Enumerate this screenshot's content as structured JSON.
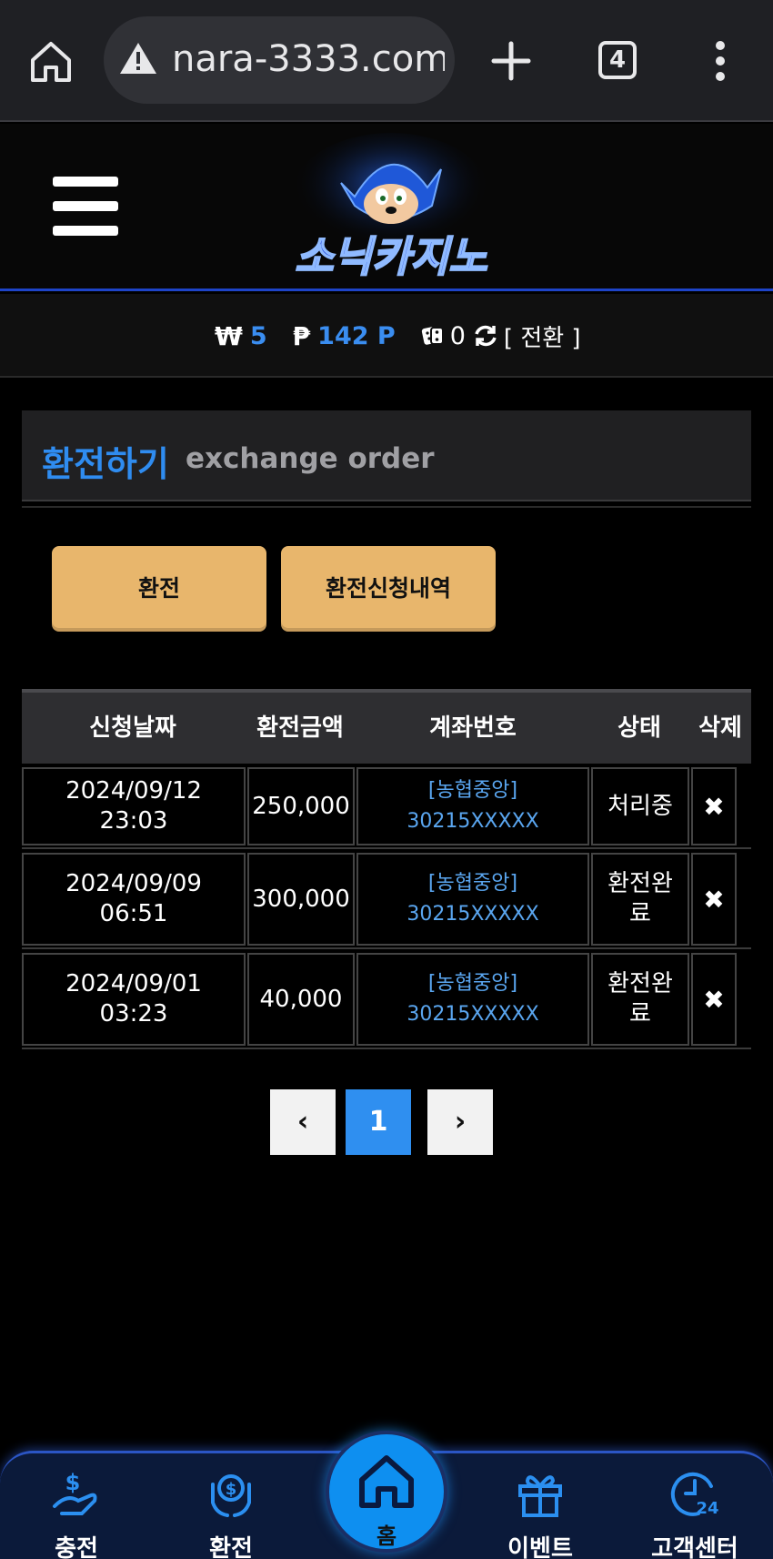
{
  "browser": {
    "url": "nara-3333.com",
    "tab_count": "4"
  },
  "header": {
    "logo_text": "소닉카지노"
  },
  "balance": {
    "won_symbol": "₩",
    "won_value": "5",
    "point_symbol": "₱",
    "point_value": "142 P",
    "dice_value": "0",
    "switch_label": "[ 전환 ]"
  },
  "page": {
    "title_ko": "환전하기",
    "title_en": "exchange order"
  },
  "actions": {
    "exchange_label": "환전",
    "history_label": "환전신청내역"
  },
  "table": {
    "headers": [
      "신청날짜",
      "환전금액",
      "계좌번호",
      "상태",
      "삭제"
    ],
    "rows": [
      {
        "date": "2024/09/12",
        "time": "23:03",
        "amount": "250,000",
        "bank": "[농협중앙]",
        "account": "30215XXXXX",
        "status": "처리중",
        "delete": "✖"
      },
      {
        "date": "2024/09/09",
        "time": "06:51",
        "amount": "300,000",
        "bank": "[농협중앙]",
        "account": "30215XXXXX",
        "status": "환전완료",
        "delete": "✖"
      },
      {
        "date": "2024/09/01",
        "time": "03:23",
        "amount": "40,000",
        "bank": "[농협중앙]",
        "account": "30215XXXXX",
        "status": "환전완료",
        "delete": "✖"
      }
    ]
  },
  "pagination": {
    "prev": "‹",
    "current": "1",
    "next": "›"
  },
  "bottom_nav": {
    "deposit": "충전",
    "exchange": "환전",
    "home": "홈",
    "event": "이벤트",
    "support": "고객센터"
  },
  "colors": {
    "accent_blue": "#2f8cf0",
    "button_gold": "#e8b66c"
  }
}
